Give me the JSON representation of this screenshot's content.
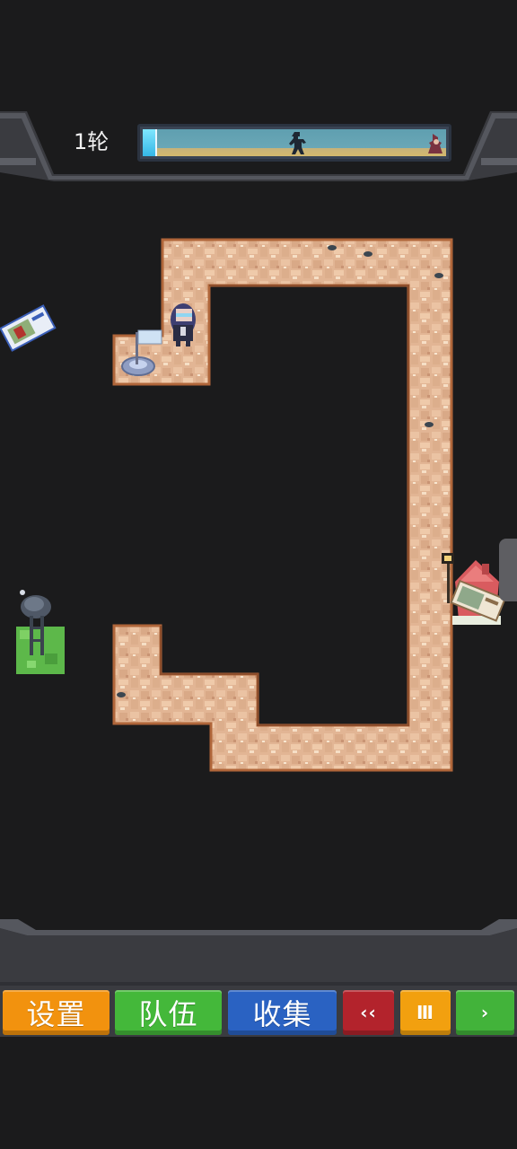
{
  "hud": {
    "round_label": "1轮",
    "round_progress": 0.04
  },
  "map": {
    "items": [
      "hero-character",
      "start-campfire-flag",
      "enemy-slime",
      "lamp-post",
      "village-house",
      "card-pickup",
      "radar-watchtower"
    ]
  },
  "bottom_bar": {
    "settings_label": "设置",
    "team_label": "队伍",
    "collect_label": "收集",
    "rewind_label": "‹‹",
    "pause_label": "Ⅲ",
    "play_label": "›"
  },
  "colors": {
    "settings": "#f2920e",
    "team": "#44b83a",
    "collect": "#2a62c2",
    "rewind": "#b3232c",
    "pause": "#f2a00f",
    "play": "#42b33a",
    "path_tile": "#e2b594",
    "path_border": "#b0663a"
  }
}
